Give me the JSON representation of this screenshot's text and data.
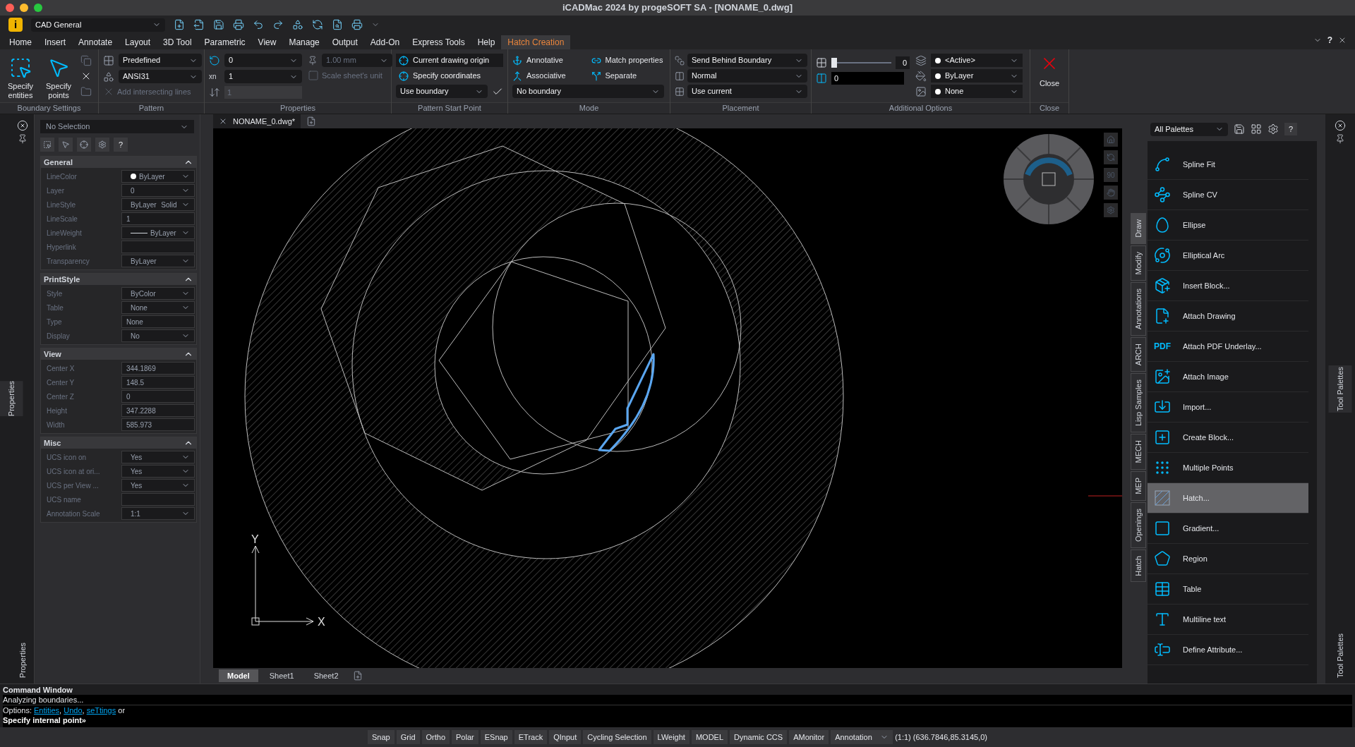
{
  "window": {
    "title": "iCADMac 2024 by progeSOFT SA - [NONAME_0.dwg]"
  },
  "quick_toolbar": {
    "logo": "i",
    "workspace": "CAD General"
  },
  "ribbon_controls": {
    "help": "?"
  },
  "menu_tabs": [
    {
      "label": "Home",
      "selected": false
    },
    {
      "label": "Insert",
      "selected": false
    },
    {
      "label": "Annotate",
      "selected": false
    },
    {
      "label": "Layout",
      "selected": false
    },
    {
      "label": "3D Tool",
      "selected": false
    },
    {
      "label": "Parametric",
      "selected": false
    },
    {
      "label": "View",
      "selected": false
    },
    {
      "label": "Manage",
      "selected": false
    },
    {
      "label": "Output",
      "selected": false
    },
    {
      "label": "Add-On",
      "selected": false
    },
    {
      "label": "Express Tools",
      "selected": false
    },
    {
      "label": "Help",
      "selected": false
    },
    {
      "label": "Hatch Creation",
      "selected": true
    }
  ],
  "ribbon": {
    "boundary_settings": {
      "title": "Boundary Settings",
      "buttons": [
        "Specify entities",
        "Specify points"
      ]
    },
    "pattern": {
      "title": "Pattern",
      "type": "Predefined",
      "name": "ANSI31",
      "intersecting": {
        "label": "Add intersecting lines",
        "disabled": true
      }
    },
    "properties": {
      "title": "Properties",
      "angle": "0",
      "scale_label": "xn",
      "scale": "1",
      "spacing": {
        "value": "1",
        "disabled": true
      },
      "lineweight": {
        "value": "1.00 mm",
        "disabled": true
      },
      "scale_sheet": {
        "label": "Scale sheet's unit",
        "disabled": true
      }
    },
    "pattern_start_point": {
      "title": "Pattern Start Point",
      "options": [
        {
          "label": "Current drawing origin",
          "selected": true
        },
        {
          "label": "Specify coordinates",
          "selected": false
        }
      ],
      "boundary": "Use boundary"
    },
    "mode": {
      "title": "Mode",
      "buttons": [
        "Annotative",
        "Match properties",
        "Associative",
        "Separate"
      ],
      "boundary": "No boundary"
    },
    "placement": {
      "title": "Placement",
      "selects": [
        "Send Behind Boundary",
        "Normal",
        "Use current"
      ]
    },
    "additional_options": {
      "title": "Additional Options",
      "transparency": {
        "level": 0,
        "value": "0"
      },
      "gap": "0",
      "selects": [
        "<Active>",
        "ByLayer",
        "None"
      ]
    },
    "close": {
      "title": "Close",
      "button": "Close"
    }
  },
  "properties_panel": {
    "tabs": [
      "Properties",
      "Properties"
    ],
    "selection": "No Selection",
    "help": "?",
    "sections": [
      {
        "title": "General",
        "expanded": true,
        "rows": [
          {
            "label": "LineColor",
            "value": "ByLayer",
            "kind": "color"
          },
          {
            "label": "Layer",
            "value": "0",
            "kind": "select"
          },
          {
            "label": "LineStyle",
            "value": "ByLayer",
            "value2": "Solid",
            "kind": "select"
          },
          {
            "label": "LineScale",
            "value": "1",
            "kind": "input"
          },
          {
            "label": "LineWeight",
            "value": "ByLayer",
            "kind": "weight"
          },
          {
            "label": "Hyperlink",
            "kind": "input"
          },
          {
            "label": "Transparency",
            "value": "ByLayer",
            "kind": "select"
          }
        ]
      },
      {
        "title": "PrintStyle",
        "expanded": true,
        "rows": [
          {
            "label": "Style",
            "value": "ByColor",
            "kind": "select"
          },
          {
            "label": "Table",
            "value": "None",
            "kind": "select"
          },
          {
            "label": "Type",
            "value": "None",
            "kind": "input"
          },
          {
            "label": "Display",
            "value": "No",
            "kind": "select"
          }
        ]
      },
      {
        "title": "View",
        "expanded": true,
        "rows": [
          {
            "label": "Center X",
            "value": "344.1869",
            "kind": "input"
          },
          {
            "label": "Center Y",
            "value": "148.5",
            "kind": "input"
          },
          {
            "label": "Center Z",
            "value": "0",
            "kind": "input"
          },
          {
            "label": "Height",
            "value": "347.2288",
            "kind": "input"
          },
          {
            "label": "Width",
            "value": "585.973",
            "kind": "input"
          }
        ]
      },
      {
        "title": "Misc",
        "expanded": true,
        "rows": [
          {
            "label": "UCS icon on",
            "value": "Yes",
            "kind": "select"
          },
          {
            "label": "UCS icon at ori...",
            "value": "Yes",
            "kind": "select"
          },
          {
            "label": "UCS per View ...",
            "value": "Yes",
            "kind": "select"
          },
          {
            "label": "UCS name",
            "kind": "input"
          },
          {
            "label": "Annotation Scale",
            "value": "1:1",
            "kind": "select"
          }
        ]
      }
    ]
  },
  "document_tabs": [
    {
      "label": "NONAME_0.dwg*",
      "selected": true
    }
  ],
  "canvas": {
    "nav_button": "90",
    "ucs_axes": [
      "X",
      "Y"
    ]
  },
  "layout_tabs": [
    {
      "label": "Model",
      "selected": true
    },
    {
      "label": "Sheet1",
      "selected": false
    },
    {
      "label": "Sheet2",
      "selected": false
    }
  ],
  "tool_palettes": {
    "tabs": [
      "Tool Palettes",
      "Tool Palettes"
    ],
    "filter": "All Palettes",
    "help": "?",
    "side_tabs": [
      {
        "label": "Draw",
        "selected": true
      },
      {
        "label": "Modify",
        "selected": false
      },
      {
        "label": "Annotations",
        "selected": false
      },
      {
        "label": "ARCH",
        "selected": false
      },
      {
        "label": "Lisp Samples",
        "selected": false
      },
      {
        "label": "MECH",
        "selected": false
      },
      {
        "label": "MEP",
        "selected": false
      },
      {
        "label": "Openings",
        "selected": false
      },
      {
        "label": "Hatch",
        "selected": false
      }
    ],
    "items": [
      {
        "label": "Spline Fit",
        "selected": false
      },
      {
        "label": "Spline CV",
        "selected": false
      },
      {
        "label": "Ellipse",
        "selected": false
      },
      {
        "label": "Elliptical Arc",
        "selected": false
      },
      {
        "label": "Insert Block...",
        "selected": false
      },
      {
        "label": "Attach Drawing",
        "selected": false
      },
      {
        "label": "Attach PDF Underlay...",
        "selected": false,
        "icon_text": "PDF"
      },
      {
        "label": "Attach Image",
        "selected": false
      },
      {
        "label": "Import...",
        "selected": false
      },
      {
        "label": "Create Block...",
        "selected": false
      },
      {
        "label": "Multiple Points",
        "selected": false
      },
      {
        "label": "Hatch...",
        "selected": true
      },
      {
        "label": "Gradient...",
        "selected": false
      },
      {
        "label": "Region",
        "selected": false
      },
      {
        "label": "Table",
        "selected": false
      },
      {
        "label": "Multiline text",
        "selected": false
      },
      {
        "label": "Define Attribute...",
        "selected": false
      }
    ]
  },
  "command_window": {
    "title": "Command Window",
    "lines": [
      {
        "kind": "plain",
        "text": "Analyzing boundaries..."
      },
      {
        "kind": "options",
        "prefix": "Options:",
        "links": [
          "Entities",
          "Undo",
          "seTtings"
        ],
        "separator": ",",
        "suffix": "or"
      },
      {
        "kind": "prompt",
        "text": "Specify internal point»"
      }
    ]
  },
  "status_bar": {
    "toggles": [
      "Snap",
      "Grid",
      "Ortho",
      "Polar",
      "ESnap",
      "ETrack",
      "QInput",
      "Cycling Selection",
      "LWeight",
      "MODEL",
      "Dynamic CCS",
      "AMonitor"
    ],
    "annotation": "Annotation",
    "scale": "(1:1)",
    "coordinates": "(636.7846,85.3145,0)"
  }
}
